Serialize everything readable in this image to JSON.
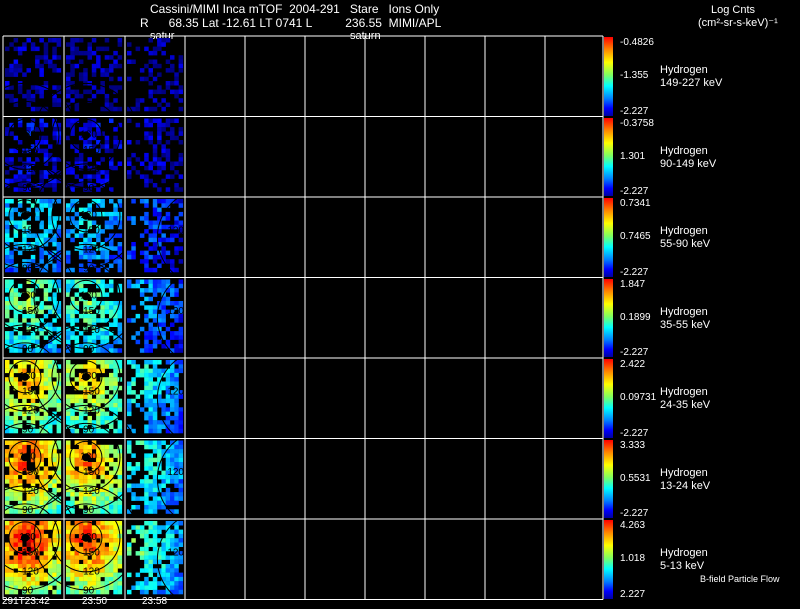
{
  "header": {
    "title": "Cassini/MIMI Inca mTOF  2004-291   Stare   Ions Only",
    "info": "R      68.35 Lat -12.61 LT 0741 L          236.55  MIMI/APL",
    "units_line1": "Log Cnts",
    "units_line2": "(cm²-sr-s-keV)⁻¹",
    "saturn_label_1": "satur",
    "saturn_label_2": "saturn"
  },
  "rows": [
    {
      "species": "Hydrogen",
      "energy": "149-227 keV",
      "cb_top": "-0.4826",
      "cb_mid": "-1.355",
      "cb_bot": "-2.227",
      "level": 0.05
    },
    {
      "species": "Hydrogen",
      "energy": "90-149 keV",
      "cb_top": "-0.3758",
      "cb_mid": "1.301",
      "cb_bot": "-2.227",
      "level": 0.12
    },
    {
      "species": "Hydrogen",
      "energy": "55-90 keV",
      "cb_top": "0.7341",
      "cb_mid": "0.7465",
      "cb_bot": "-2.227",
      "level": 0.4
    },
    {
      "species": "Hydrogen",
      "energy": "35-55 keV",
      "cb_top": "1.847",
      "cb_mid": "0.1899",
      "cb_bot": "-2.227",
      "level": 0.55
    },
    {
      "species": "Hydrogen",
      "energy": "24-35 keV",
      "cb_top": "2.422",
      "cb_mid": "0.09731",
      "cb_bot": "-2.227",
      "level": 0.75
    },
    {
      "species": "Hydrogen",
      "energy": "13-24 keV",
      "cb_top": "3.333",
      "cb_mid": "0.5531",
      "cb_bot": "-2.227",
      "level": 0.85
    },
    {
      "species": "Hydrogen",
      "energy": "5-13 keV",
      "cb_top": "4.263",
      "cb_mid": "1.018",
      "cb_bot": "2.227",
      "level": 0.92
    }
  ],
  "contour_labels": [
    "180",
    "150",
    "120",
    "90"
  ],
  "footer": {
    "time_1": "291T23:42",
    "time_2": "23:50",
    "time_3": "23:58",
    "legend": "B-field Particle Flow"
  },
  "colors": {
    "grid": "#ffffff",
    "background": "#000000"
  }
}
